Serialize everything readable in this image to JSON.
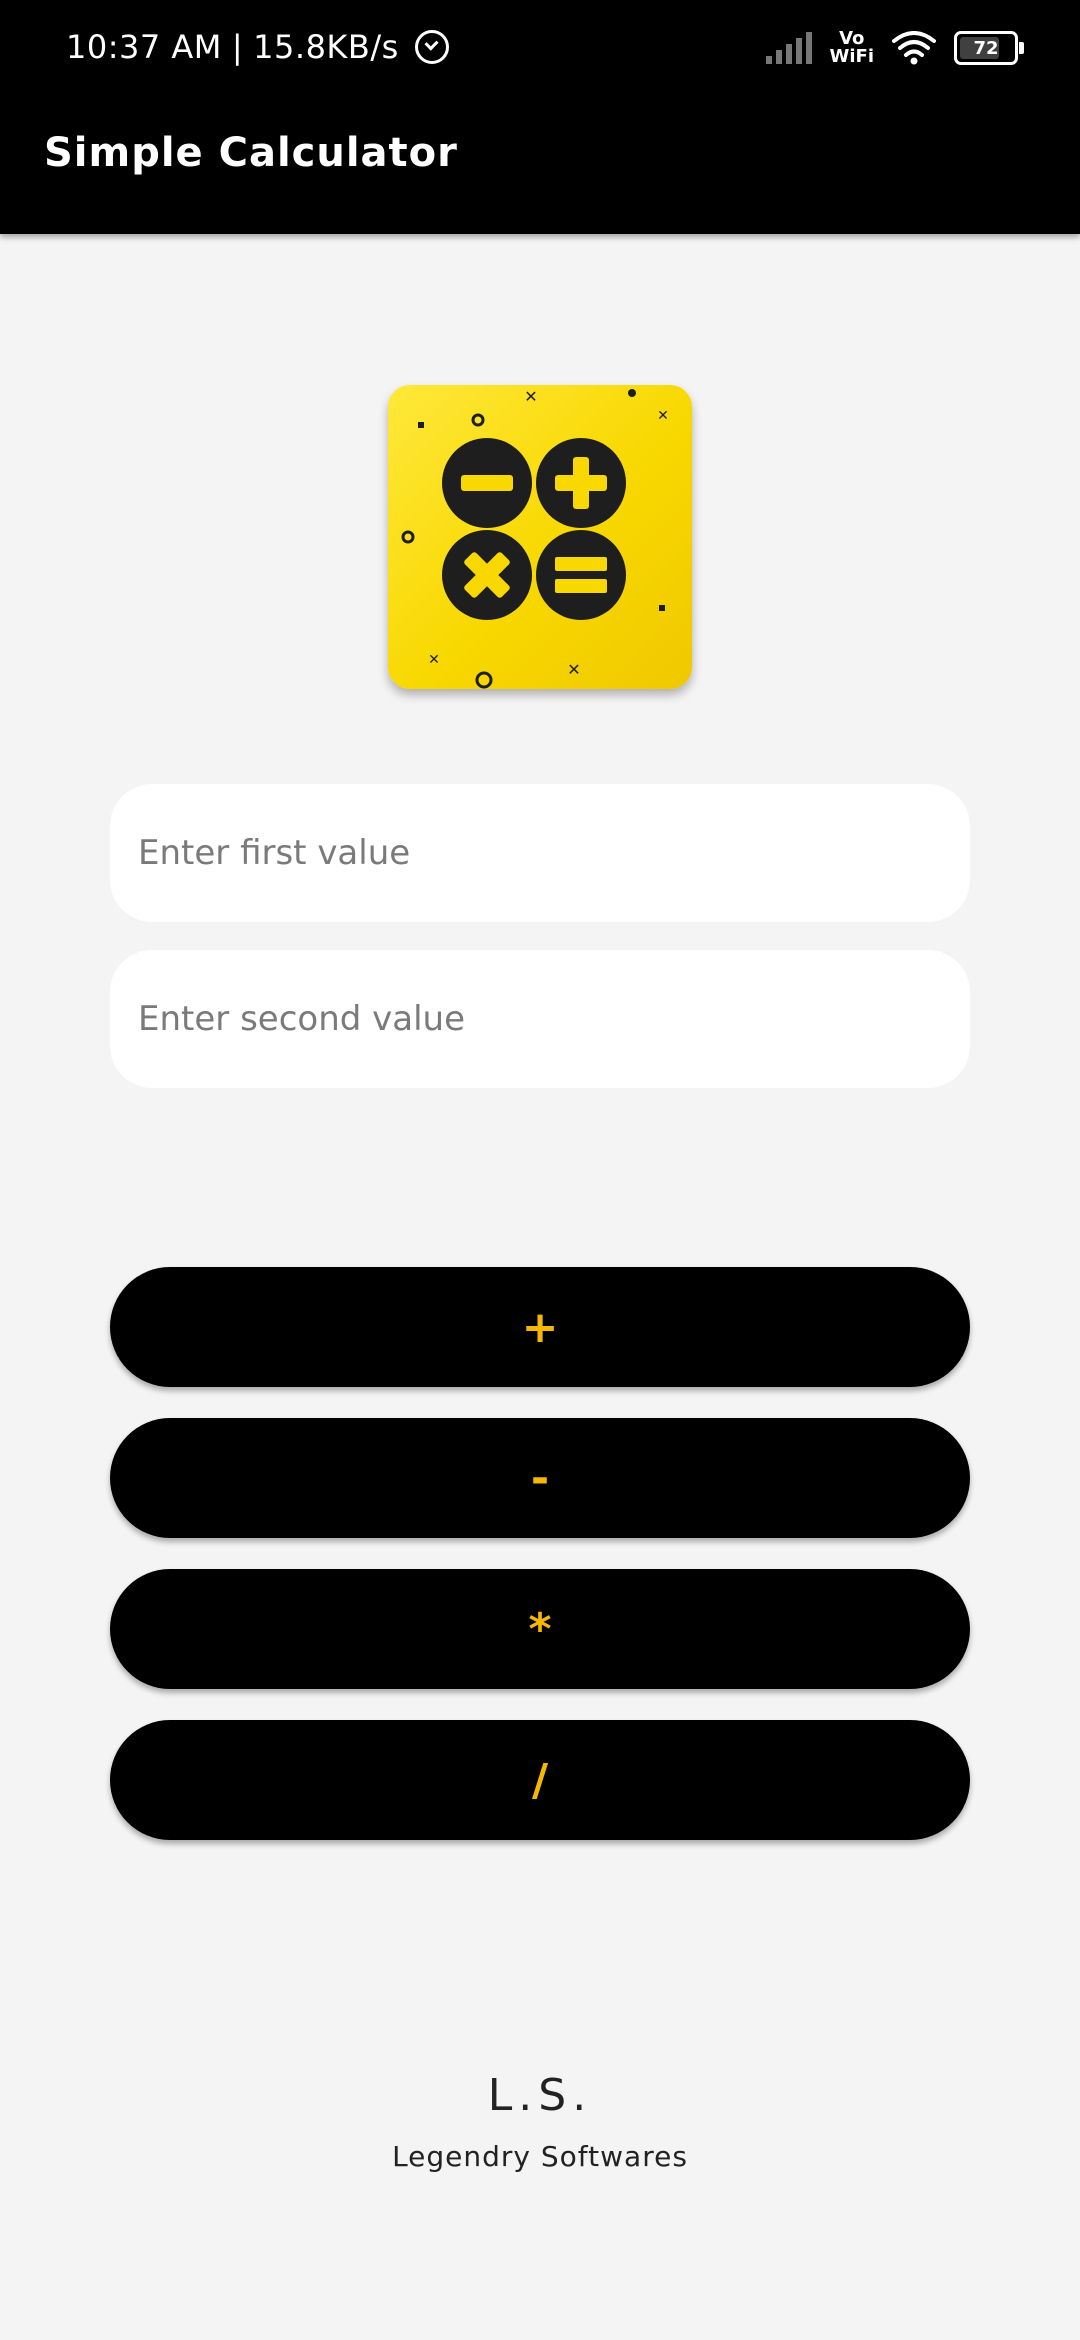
{
  "status_bar": {
    "time": "10:37 AM",
    "separator": "|",
    "network_speed": "15.8KB/s",
    "vowifi_top": "Vo",
    "vowifi_bottom": "WiFi",
    "battery_level": "72",
    "icons": [
      "alarm-icon",
      "signal-icon",
      "vowifi-icon",
      "wifi-icon",
      "battery-icon"
    ]
  },
  "app_bar": {
    "title": "Simple Calculator"
  },
  "inputs": {
    "first": {
      "value": "",
      "placeholder": "Enter first value"
    },
    "second": {
      "value": "",
      "placeholder": "Enter second value"
    }
  },
  "operations": {
    "add": "+",
    "subtract": "-",
    "multiply": "*",
    "divide": "/"
  },
  "footer": {
    "brand": "L.S.",
    "company": "Legendry Softwares"
  },
  "colors": {
    "status_bar": "#000000",
    "app_bar": "#000000",
    "background": "#f4f4f4",
    "button_background": "#000000",
    "button_text": "#f5b800",
    "logo_yellow": "#f8d800",
    "logo_dark": "#1e1e1e"
  }
}
